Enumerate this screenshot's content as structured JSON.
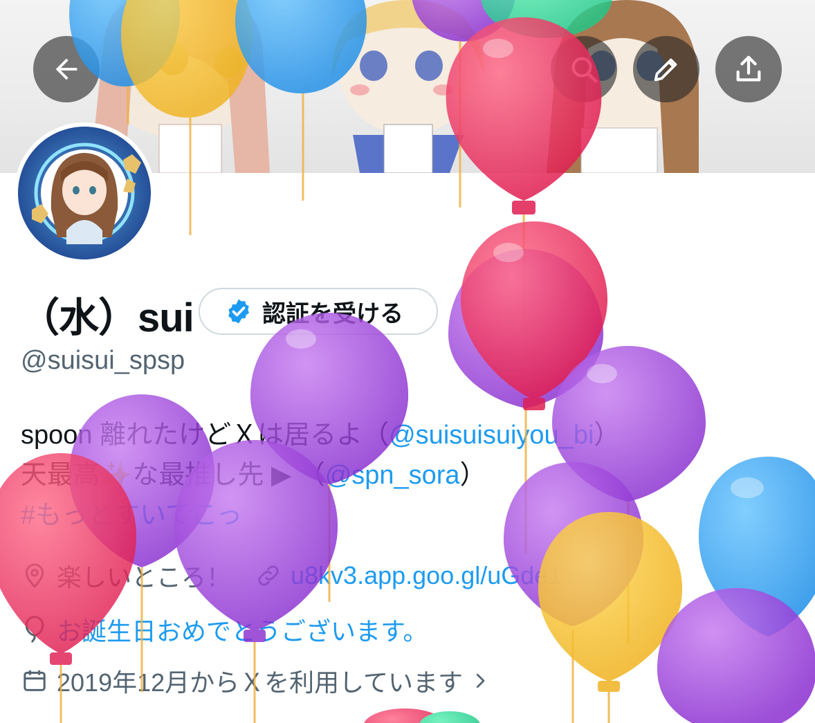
{
  "profile": {
    "display_name": "（水）sui",
    "verify_label": "認証を受ける",
    "handle": "@suisui_spsp"
  },
  "bio": {
    "line1_text": "spoon 離れたけどＸは居るよ（",
    "line1_mention": "@suisuisuiyou_bi",
    "line1_end": "）",
    "line2_text": "天最高✨な最推し先 ▶︎ （",
    "line2_mention": "@spn_sora",
    "line2_end": "）",
    "line3_hashtag": "#もっとすいてこっ"
  },
  "meta": {
    "location": "楽しいところ！",
    "website": "u8kv3.app.goo.gl/uGde1",
    "birthday": "お誕生日おめでとうございます。",
    "joined": "2019年12月からＸを利用しています"
  },
  "icons": {
    "back": "arrow-left-icon",
    "search": "search-icon",
    "edit": "pencil-icon",
    "share": "share-icon",
    "verified": "verified-badge-icon",
    "location": "location-pin-icon",
    "link": "link-icon",
    "birthday": "balloon-icon",
    "calendar": "calendar-icon",
    "chevron": "chevron-right-icon"
  },
  "colors": {
    "link": "#1d9bf0",
    "muted": "#536471",
    "verified": "#1d9bf0"
  }
}
